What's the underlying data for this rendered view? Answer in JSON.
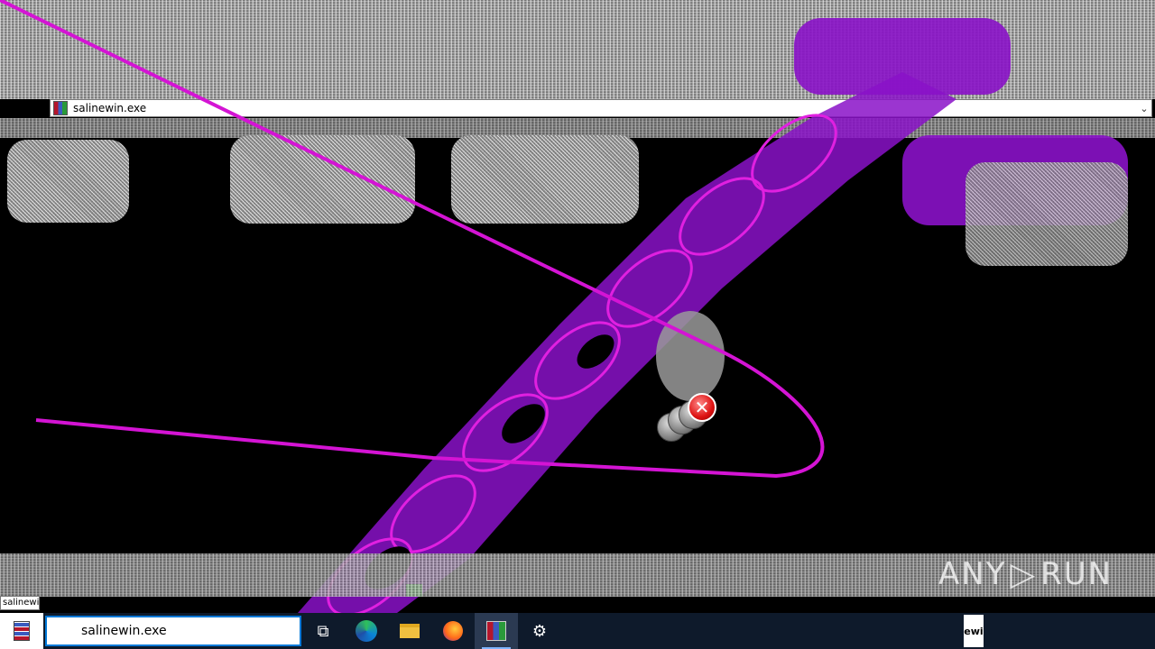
{
  "window": {
    "address_bar_text": "salinewin.exe",
    "chevron": "⌄"
  },
  "tooltip": {
    "text": "salinewi"
  },
  "taskbar": {
    "search_value": "salinewin.exe",
    "task_view_glyph": "⧉",
    "settings_glyph": "⚙",
    "right_label": "ewi"
  },
  "error_icon": {
    "glyph": "✕"
  },
  "watermark": {
    "left": "ANY",
    "play": "▷",
    "right": "RUN"
  },
  "colors": {
    "glitch_magenta": "#d414d4",
    "purple": "#8a12c8",
    "taskbar_bg": "#0e1a2b",
    "search_border": "#0078d7"
  }
}
